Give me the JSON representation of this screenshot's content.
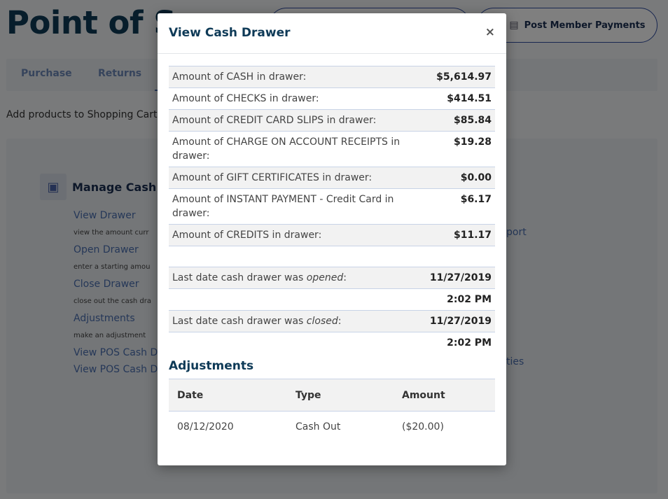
{
  "page": {
    "title": "Point of Sa",
    "post_member_payments": "Post Member Payments",
    "tabs": [
      {
        "label": "Purchase"
      },
      {
        "label": "Returns"
      }
    ],
    "cart_hint": "Add products to Shopping Cart",
    "manage_title": "Manage Cash D",
    "links": [
      {
        "label": "View Drawer",
        "desc": "view the amount curr"
      },
      {
        "label": "Open Drawer",
        "desc": "enter a starting amou"
      },
      {
        "label": "Close Drawer",
        "desc": "close out the cash dra"
      },
      {
        "label": "Adjustments",
        "desc": "make an adjustment"
      },
      {
        "label": "View POS Cash D"
      },
      {
        "label": "View POS Cash D"
      }
    ],
    "right_links": [
      "port",
      "ties"
    ]
  },
  "modal": {
    "title": "View Cash Drawer",
    "close": "×",
    "rows": [
      {
        "label": "Amount of CASH in drawer:",
        "value": "$5,614.97"
      },
      {
        "label": "Amount of CHECKS in drawer:",
        "value": "$414.51"
      },
      {
        "label": "Amount of CREDIT CARD SLIPS in drawer:",
        "value": "$85.84"
      },
      {
        "label": "Amount of CHARGE ON ACCOUNT RECEIPTS in drawer:",
        "value": "$19.28"
      },
      {
        "label": "Amount of GIFT CERTIFICATES in drawer:",
        "value": "$0.00"
      },
      {
        "label": "Amount of INSTANT PAYMENT - Credit Card in drawer:",
        "value": "$6.17"
      },
      {
        "label": "Amount of CREDITS in drawer:",
        "value": "$11.17"
      }
    ],
    "opened": {
      "prefix": "Last date cash drawer was ",
      "word": "opened",
      "suffix": ":",
      "date": "11/27/2019",
      "time": "2:02 PM"
    },
    "closed": {
      "prefix": "Last date cash drawer was ",
      "word": "closed",
      "suffix": ":",
      "date": "11/27/2019",
      "time": "2:02 PM"
    },
    "adjustments": {
      "title": "Adjustments",
      "headers": {
        "date": "Date",
        "type": "Type",
        "amount": "Amount"
      },
      "rows": [
        {
          "date": "08/12/2020",
          "type": "Cash Out",
          "amount": "($20.00)"
        }
      ]
    }
  }
}
